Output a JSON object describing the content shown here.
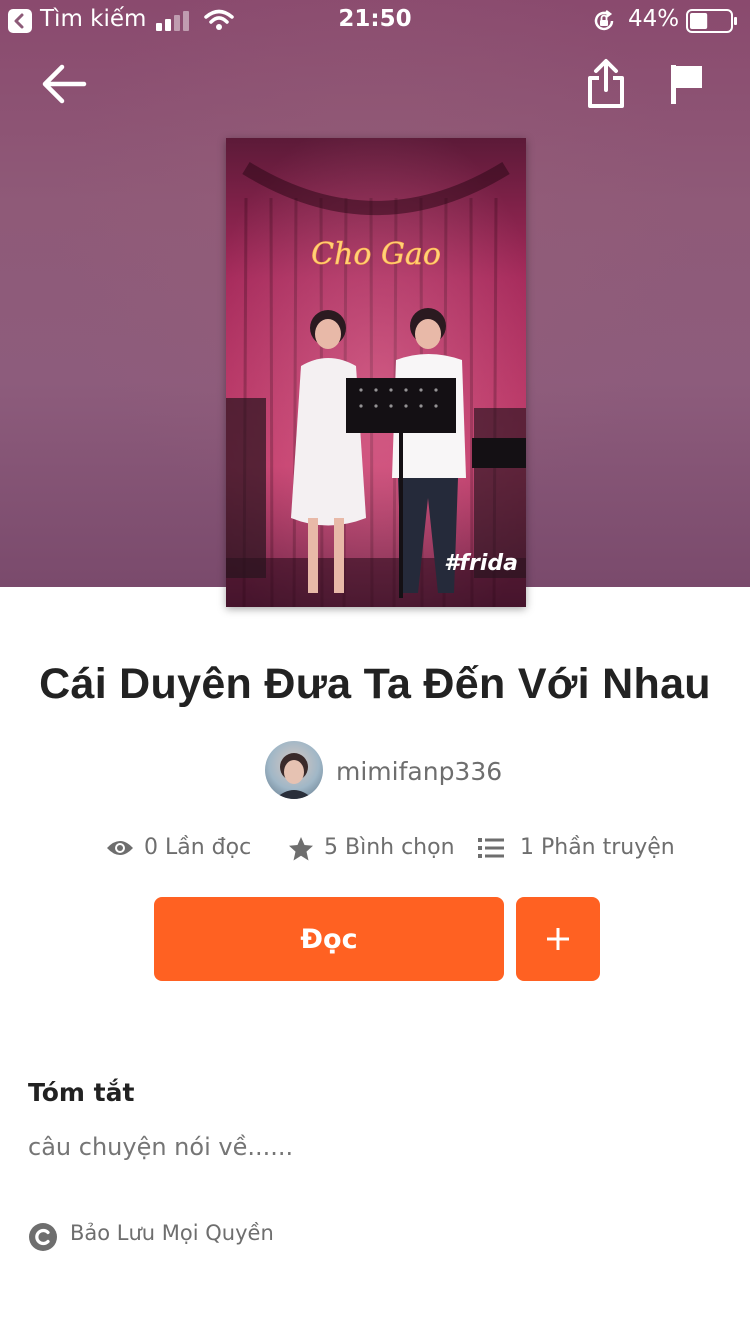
{
  "status_bar": {
    "back_label": "Tìm kiếm",
    "time": "21:50",
    "battery_percent": "44%",
    "battery_level": 0.44
  },
  "story": {
    "cover_sign_text": "Cho Gao",
    "cover_hashtag": "#frida",
    "title": "Cái Duyên Đưa Ta Đến Với Nhau",
    "author": "mimifanp336"
  },
  "stats": {
    "reads": "0 Lần đọc",
    "votes": "5 Bình chọn",
    "parts": "1 Phần truyện"
  },
  "actions": {
    "read_label": "Đọc",
    "add_label": "+"
  },
  "summary": {
    "heading": "Tóm tắt",
    "text": "câu chuyện nói về......"
  },
  "copyright": {
    "text": "Bảo Lưu Mọi Quyền"
  },
  "colors": {
    "accent": "#ff6122",
    "header_bg": "#8d5a78",
    "muted_text": "#6e6e6e"
  }
}
